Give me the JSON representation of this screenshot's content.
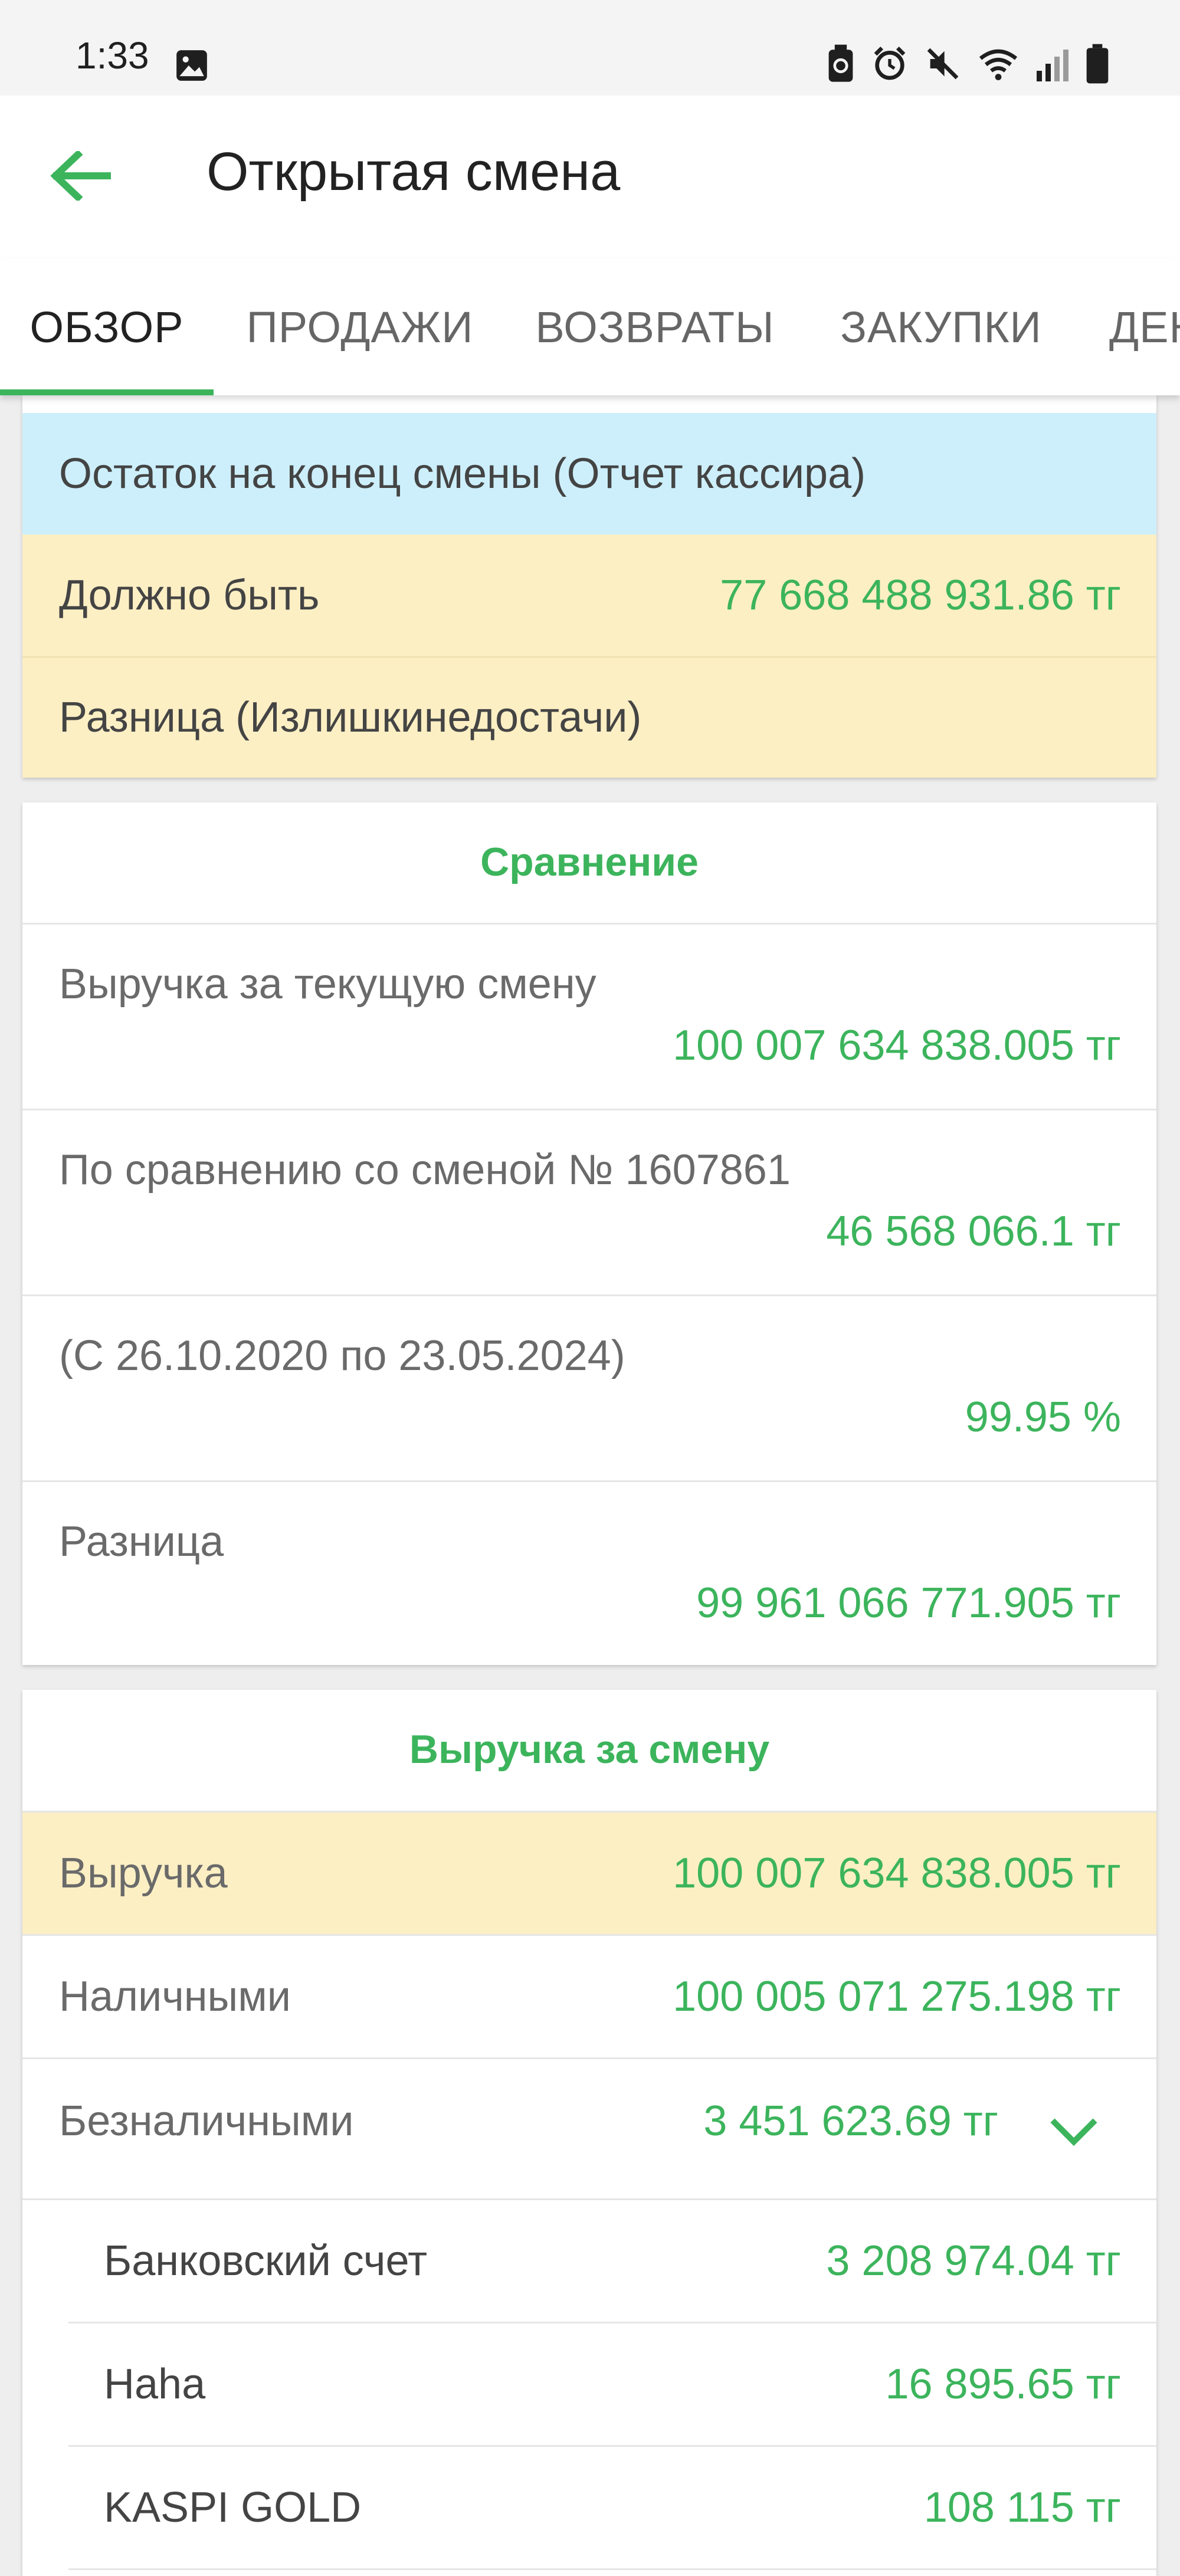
{
  "status_bar": {
    "time": "1:33",
    "icons": [
      "image-icon",
      "battery-saver-icon",
      "alarm-icon",
      "mute-icon",
      "wifi-icon",
      "signal-icon",
      "battery-icon"
    ]
  },
  "app_bar": {
    "title": "Открытая смена",
    "back_icon": "arrow-back-icon",
    "accent_color": "#3cb45c"
  },
  "tabs": [
    {
      "label": "ОБЗОР",
      "active": true
    },
    {
      "label": "ПРОДАЖИ",
      "active": false
    },
    {
      "label": "ВОЗВРАТЫ",
      "active": false
    },
    {
      "label": "ЗАКУПКИ",
      "active": false
    },
    {
      "label": "ДЕН",
      "active": false
    }
  ],
  "end_of_shift_card": {
    "header": "Остаток на конец смены (Отчет кассира)",
    "expected_label": "Должно быть",
    "expected_value": "77 668 488 931.86 тг",
    "difference_label": "Разница (Излишкинедостачи)"
  },
  "comparison_card": {
    "title": "Сравнение",
    "rows": [
      {
        "label": "Выручка за текущую смену",
        "value": "100 007 634 838.005 тг"
      },
      {
        "label": "По сравнению со сменой № 1607861",
        "value": "46 568 066.1 тг"
      },
      {
        "label": "(С 26.10.2020 по 23.05.2024)",
        "value": "99.95 %"
      },
      {
        "label": "Разница",
        "value": "99 961 066 771.905 тг"
      }
    ]
  },
  "revenue_card": {
    "title": "Выручка за смену",
    "revenue_label": "Выручка",
    "revenue_value": "100 007 634 838.005 тг",
    "cash_label": "Наличными",
    "cash_value": "100 005 071 275.198 тг",
    "noncash_label": "Безналичными",
    "noncash_value": "3 451 623.69 тг",
    "noncash_items": [
      {
        "label": "Банковский счет",
        "value": "3 208 974.04 тг"
      },
      {
        "label": "Haha",
        "value": "16 895.65 тг"
      },
      {
        "label": "KASPI GOLD",
        "value": "108 115 тг"
      }
    ]
  }
}
